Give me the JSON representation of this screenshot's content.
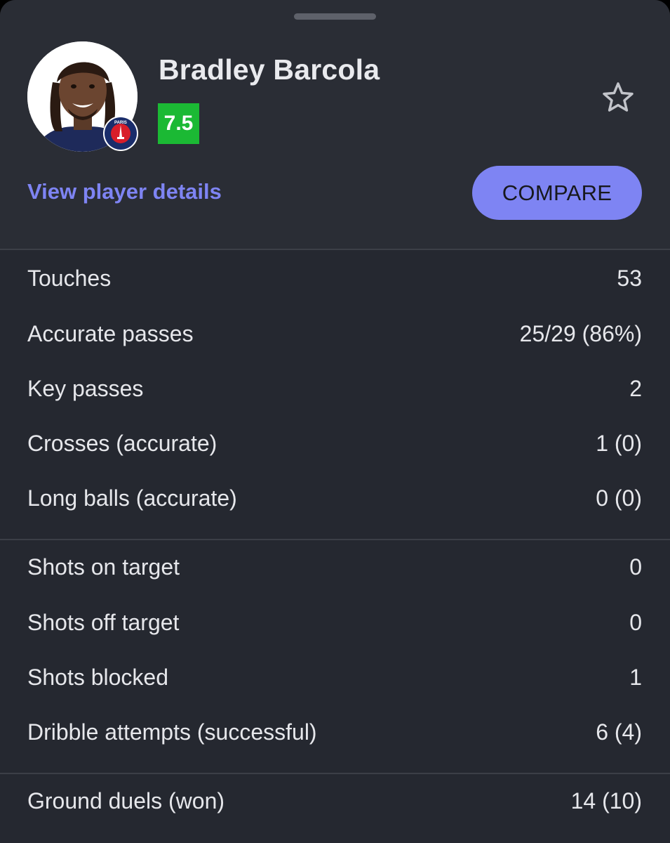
{
  "player": {
    "name": "Bradley Barcola",
    "rating": "7.5",
    "club_badge_text": "PARIS",
    "avatar_icon": "player-photo-icon",
    "favorite_icon": "star-outline-icon"
  },
  "actions": {
    "view_details_label": "View player details",
    "compare_label": "COMPARE"
  },
  "colors": {
    "accent": "#7e84f3",
    "rating_green": "#1bb934",
    "background": "#252830"
  },
  "stat_groups": [
    {
      "rows": [
        {
          "label": "Touches",
          "value": "53"
        },
        {
          "label": "Accurate passes",
          "value": "25/29 (86%)"
        },
        {
          "label": "Key passes",
          "value": "2"
        },
        {
          "label": "Crosses (accurate)",
          "value": "1 (0)"
        },
        {
          "label": "Long balls (accurate)",
          "value": "0 (0)"
        }
      ]
    },
    {
      "rows": [
        {
          "label": "Shots on target",
          "value": "0"
        },
        {
          "label": "Shots off target",
          "value": "0"
        },
        {
          "label": "Shots blocked",
          "value": "1"
        },
        {
          "label": "Dribble attempts (successful)",
          "value": "6 (4)"
        }
      ]
    },
    {
      "rows": [
        {
          "label": "Ground duels (won)",
          "value": "14 (10)"
        }
      ]
    }
  ]
}
